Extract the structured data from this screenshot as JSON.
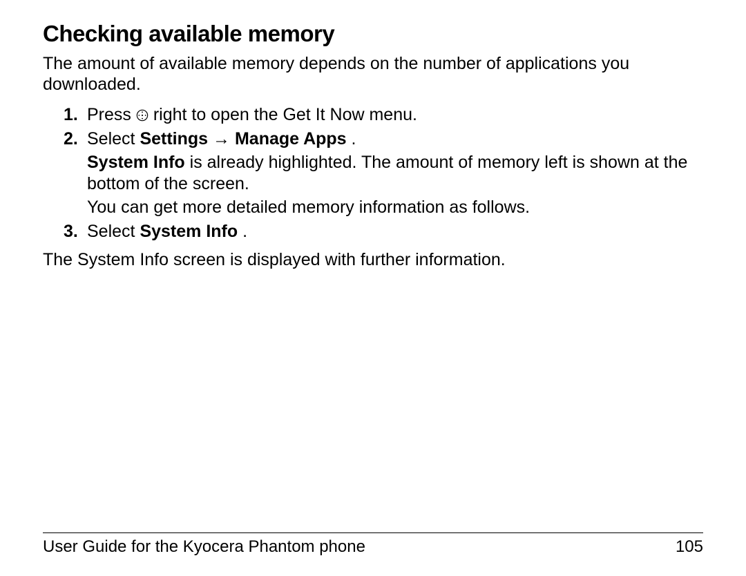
{
  "heading": "Checking available memory",
  "intro": "The amount of available memory depends on the number of applications you downloaded.",
  "steps": {
    "s1": {
      "num": "1.",
      "before": " Press ",
      "after": " right to open the Get It Now menu."
    },
    "s2": {
      "num": "2.",
      "select": " Select ",
      "bold1": "Settings",
      "arrow": "→",
      "bold2": " Manage Apps",
      "period": ".",
      "extra1_b": "System Info",
      "extra1_rest": " is already highlighted. The amount of memory left is shown at the bottom of the screen.",
      "extra2": "You can get more detailed memory information as follows."
    },
    "s3": {
      "num": "3.",
      "select": " Select ",
      "bold": "System Info",
      "period": "."
    }
  },
  "outro": "The System Info screen is displayed with further information.",
  "footer": {
    "title": "User Guide for the Kyocera Phantom phone",
    "page": "105"
  }
}
